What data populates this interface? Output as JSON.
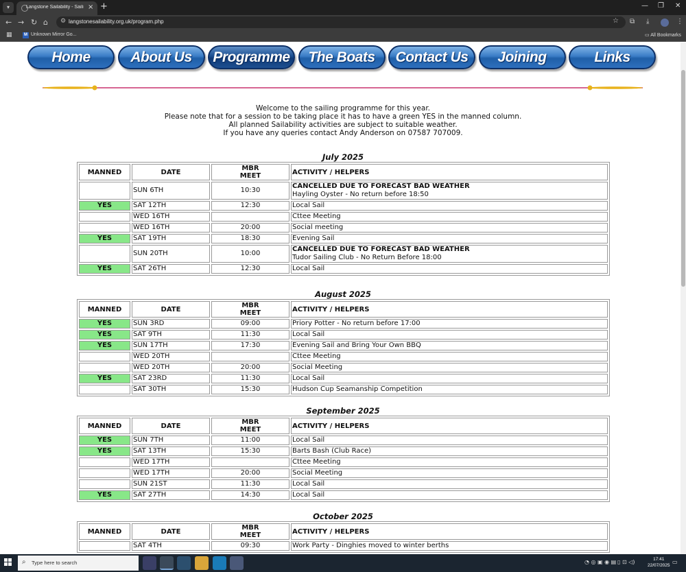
{
  "browser": {
    "tab_title": "Langstone Sailability - Sailing P",
    "url": "langstonesailability.org.uk/program.php",
    "bookmark": "Unknown Mirror Go...",
    "all_bookmarks": "All Bookmarks"
  },
  "nav": [
    "Home",
    "About Us",
    "Programme",
    "The Boats",
    "Contact Us",
    "Joining",
    "Links"
  ],
  "intro": [
    "Welcome to the sailing programme for this year.",
    "Please note that for a session to be taking place it has to have a green YES in the manned column.",
    "All planned Sailability activities are subject to suitable weather.",
    "If you have any queries contact Andy Anderson on 07587 707009."
  ],
  "table_headers": {
    "manned": "MANNED",
    "date": "DATE",
    "meet_line1": "MBR",
    "meet_line2": "MEET",
    "activity": "ACTIVITY / HELPERS"
  },
  "months": [
    {
      "title": "July 2025",
      "rows": [
        {
          "manned": "",
          "date": "SUN 6TH",
          "meet": "10:30",
          "activity_bold": "CANCELLED DUE TO FORECAST BAD WEATHER",
          "activity": "Hayling Oyster - No return before 18:50"
        },
        {
          "manned": "YES",
          "date": "SAT 12TH",
          "meet": "12:30",
          "activity_bold": "",
          "activity": "Local Sail"
        },
        {
          "manned": "",
          "date": "WED 16TH",
          "meet": "",
          "activity_bold": "",
          "activity": "Cttee Meeting"
        },
        {
          "manned": "",
          "date": "WED 16TH",
          "meet": "20:00",
          "activity_bold": "",
          "activity": "Social meeting"
        },
        {
          "manned": "YES",
          "date": "SAT 19TH",
          "meet": "18:30",
          "activity_bold": "",
          "activity": "Evening Sail"
        },
        {
          "manned": "",
          "date": "SUN 20TH",
          "meet": "10:00",
          "activity_bold": "CANCELLED DUE TO FORECAST BAD WEATHER",
          "activity": "Tudor Sailing Club - No Return Before 18:00"
        },
        {
          "manned": "YES",
          "date": "SAT 26TH",
          "meet": "12:30",
          "activity_bold": "",
          "activity": "Local Sail"
        }
      ]
    },
    {
      "title": "August 2025",
      "rows": [
        {
          "manned": "YES",
          "date": "SUN 3RD",
          "meet": "09:00",
          "activity_bold": "",
          "activity": "Priory Potter - No return before 17:00"
        },
        {
          "manned": "YES",
          "date": "SAT 9TH",
          "meet": "11:30",
          "activity_bold": "",
          "activity": "Local Sail"
        },
        {
          "manned": "YES",
          "date": "SUN 17TH",
          "meet": "17:30",
          "activity_bold": "",
          "activity": "Evening Sail and Bring Your Own BBQ"
        },
        {
          "manned": "",
          "date": "WED 20TH",
          "meet": "",
          "activity_bold": "",
          "activity": "Cttee Meeting"
        },
        {
          "manned": "",
          "date": "WED 20TH",
          "meet": "20:00",
          "activity_bold": "",
          "activity": "Social Meeting"
        },
        {
          "manned": "YES",
          "date": "SAT 23RD",
          "meet": "11:30",
          "activity_bold": "",
          "activity": "Local Sail"
        },
        {
          "manned": "",
          "date": "SAT 30TH",
          "meet": "15:30",
          "activity_bold": "",
          "activity": "Hudson Cup Seamanship Competition"
        }
      ]
    },
    {
      "title": "September 2025",
      "rows": [
        {
          "manned": "YES",
          "date": "SUN 7TH",
          "meet": "11:00",
          "activity_bold": "",
          "activity": "Local Sail"
        },
        {
          "manned": "YES",
          "date": "SAT 13TH",
          "meet": "15:30",
          "activity_bold": "",
          "activity": "Barts Bash (Club Race)"
        },
        {
          "manned": "",
          "date": "WED 17TH",
          "meet": "",
          "activity_bold": "",
          "activity": "Cttee Meeting"
        },
        {
          "manned": "",
          "date": "WED 17TH",
          "meet": "20:00",
          "activity_bold": "",
          "activity": "Social Meeting"
        },
        {
          "manned": "",
          "date": "SUN 21ST",
          "meet": "11:30",
          "activity_bold": "",
          "activity": "Local Sail"
        },
        {
          "manned": "YES",
          "date": "SAT 27TH",
          "meet": "14:30",
          "activity_bold": "",
          "activity": "Local Sail"
        }
      ]
    },
    {
      "title": "October 2025",
      "rows": [
        {
          "manned": "",
          "date": "SAT 4TH",
          "meet": "09:30",
          "activity_bold": "",
          "activity": "Work Party - Dinghies moved to winter berths"
        }
      ]
    }
  ],
  "taskbar": {
    "search_placeholder": "Type here to search",
    "time": "17:41",
    "date": "22/07/2025"
  },
  "colors": {
    "manned_yes": "#88e788",
    "nav_blue": "#1f5fa8",
    "divider_gold": "#e8b21c",
    "divider_red": "#c8326e"
  }
}
